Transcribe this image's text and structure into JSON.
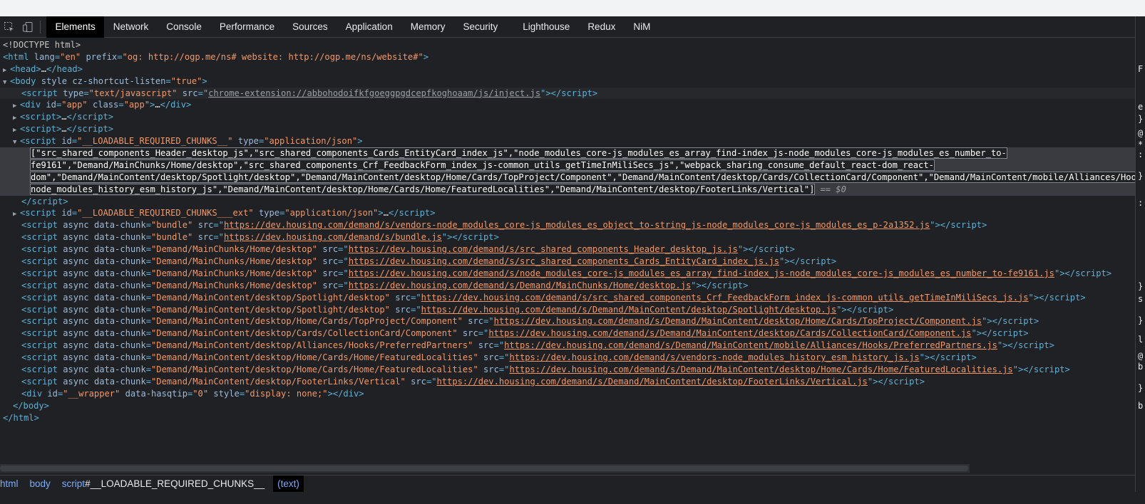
{
  "toolbar": {
    "tabs": [
      "Elements",
      "Network",
      "Console",
      "Performance",
      "Sources",
      "Application",
      "Memory",
      "Security",
      "Lighthouse",
      "Redux",
      "NiM"
    ],
    "icons": [
      "inspect-element-icon",
      "device-toolbar-icon"
    ]
  },
  "dom": {
    "l1": "<!DOCTYPE html>",
    "l2_attr_lang": "lang",
    "l2_val_lang": "\"en\"",
    "l2_attr_prefix": "prefix",
    "l2_val_prefix": "\"og: http://ogp.me/ns# website: http://ogp.me/ns/website#\"",
    "head": "<head>",
    "head_close": "</head>",
    "body_open": "<body",
    "body_attr_style": "style",
    "body_attr_cz": "cz-shortcut-listen",
    "body_val_cz": "\"true\"",
    "script_type": "type",
    "script_type_val": "\"text/javascript\"",
    "src": "src",
    "inject_src": "chrome-extension://abbohodoifkfgoeggpgdcepfkoghoaam/js/inject.js",
    "div_app_id": "\"app\"",
    "div_app_class": "\"app\"",
    "loadable_id": "\"__LOADABLE_REQUIRED_CHUNKS__\"",
    "loadable_type": "\"application/json\"",
    "json_lines": [
      "[\"src_shared_components_Header_desktop_js\",\"src_shared_components_Cards_EntityCard_index_js\",\"node_modules_core-js_modules_es_array_find-index_js-node_modules_core-js_modules_es_number_to-",
      "fe9161\",\"Demand/MainChunks/Home/desktop\",\"src_shared_components_Crf_FeedbackForm_index_js-common_utils_getTimeInMiliSecs_js\",\"webpack_sharing_consume_default_react-dom_react-",
      "dom\",\"Demand/MainContent/desktop/Spotlight/desktop\",\"Demand/MainContent/desktop/Home/Cards/TopProject/Component\",\"Demand/MainContent/desktop/Cards/CollectionCard/Component\",\"Demand/MainContent/mobile/Alliances/Hooks/PreferredPartners\",\"vendors-",
      "node_modules_history_esm_history_js\",\"Demand/MainContent/desktop/Home/Cards/Home/FeaturedLocalities\",\"Demand/MainContent/desktop/FooterLinks/Vertical\"]"
    ],
    "dollar_marker": "== $0",
    "loadable_ext_id": "\"__LOADABLE_REQUIRED_CHUNKS___ext\"",
    "chunk_scripts": [
      {
        "chunk": "\"bundle\"",
        "src": "https://dev.housing.com/demand/s/vendors-node_modules_core-js_modules_es_object_to-string_js-node_modules_core-js_modules_es_p-2a1352.js"
      },
      {
        "chunk": "\"bundle\"",
        "src": "https://dev.housing.com/demand/s/bundle.js"
      },
      {
        "chunk": "\"Demand/MainChunks/Home/desktop\"",
        "src": "https://dev.housing.com/demand/s/src_shared_components_Header_desktop_js.js"
      },
      {
        "chunk": "\"Demand/MainChunks/Home/desktop\"",
        "src": "https://dev.housing.com/demand/s/src_shared_components_Cards_EntityCard_index_js.js"
      },
      {
        "chunk": "\"Demand/MainChunks/Home/desktop\"",
        "src": "https://dev.housing.com/demand/s/node_modules_core-js_modules_es_array_find-index_js-node_modules_core-js_modules_es_number_to-fe9161.js"
      },
      {
        "chunk": "\"Demand/MainChunks/Home/desktop\"",
        "src": "https://dev.housing.com/demand/s/Demand/MainChunks/Home/desktop.js"
      },
      {
        "chunk": "\"Demand/MainContent/desktop/Spotlight/desktop\"",
        "src": "https://dev.housing.com/demand/s/src_shared_components_Crf_FeedbackForm_index_js-common_utils_getTimeInMiliSecs_js.js"
      },
      {
        "chunk": "\"Demand/MainContent/desktop/Spotlight/desktop\"",
        "src": "https://dev.housing.com/demand/s/Demand/MainContent/desktop/Spotlight/desktop.js"
      },
      {
        "chunk": "\"Demand/MainContent/desktop/Home/Cards/TopProject/Component\"",
        "src": "https://dev.housing.com/demand/s/Demand/MainContent/desktop/Home/Cards/TopProject/Component.js"
      },
      {
        "chunk": "\"Demand/MainContent/desktop/Cards/CollectionCard/Component\"",
        "src": "https://dev.housing.com/demand/s/Demand/MainContent/desktop/Cards/CollectionCard/Component.js"
      },
      {
        "chunk": "\"Demand/MainContent/desktop/Alliances/Hooks/PreferredPartners\"",
        "src": "https://dev.housing.com/demand/s/Demand/MainContent/mobile/Alliances/Hooks/PreferredPartners.js"
      },
      {
        "chunk": "\"Demand/MainContent/desktop/Home/Cards/Home/FeaturedLocalities\"",
        "src": "https://dev.housing.com/demand/s/vendors-node_modules_history_esm_history_js.js"
      },
      {
        "chunk": "\"Demand/MainContent/desktop/Home/Cards/Home/FeaturedLocalities\"",
        "src": "https://dev.housing.com/demand/s/Demand/MainContent/desktop/Home/Cards/Home/FeaturedLocalities.js"
      },
      {
        "chunk": "\"Demand/MainContent/desktop/FooterLinks/Vertical\"",
        "src": "https://dev.housing.com/demand/s/Demand/MainContent/desktop/FooterLinks/Vertical.js"
      }
    ],
    "wrapper_id": "\"__wrapper\"",
    "wrapper_hasqtip": "\"0\"",
    "wrapper_style": "\"display: none;\"",
    "body_close": "</body>",
    "html_close": "</html>"
  },
  "breadcrumbs": {
    "html": "html",
    "body": "body",
    "script": "script",
    "script_id": "#__LOADABLE_REQUIRED_CHUNKS__",
    "text": "(text)"
  },
  "side_panel_glyphs": [
    "e",
    "}",
    "@",
    "*",
    ":",
    "}",
    "F",
    ":",
    "}",
    "s",
    "}",
    "l",
    "@",
    "b",
    "}",
    "b"
  ]
}
